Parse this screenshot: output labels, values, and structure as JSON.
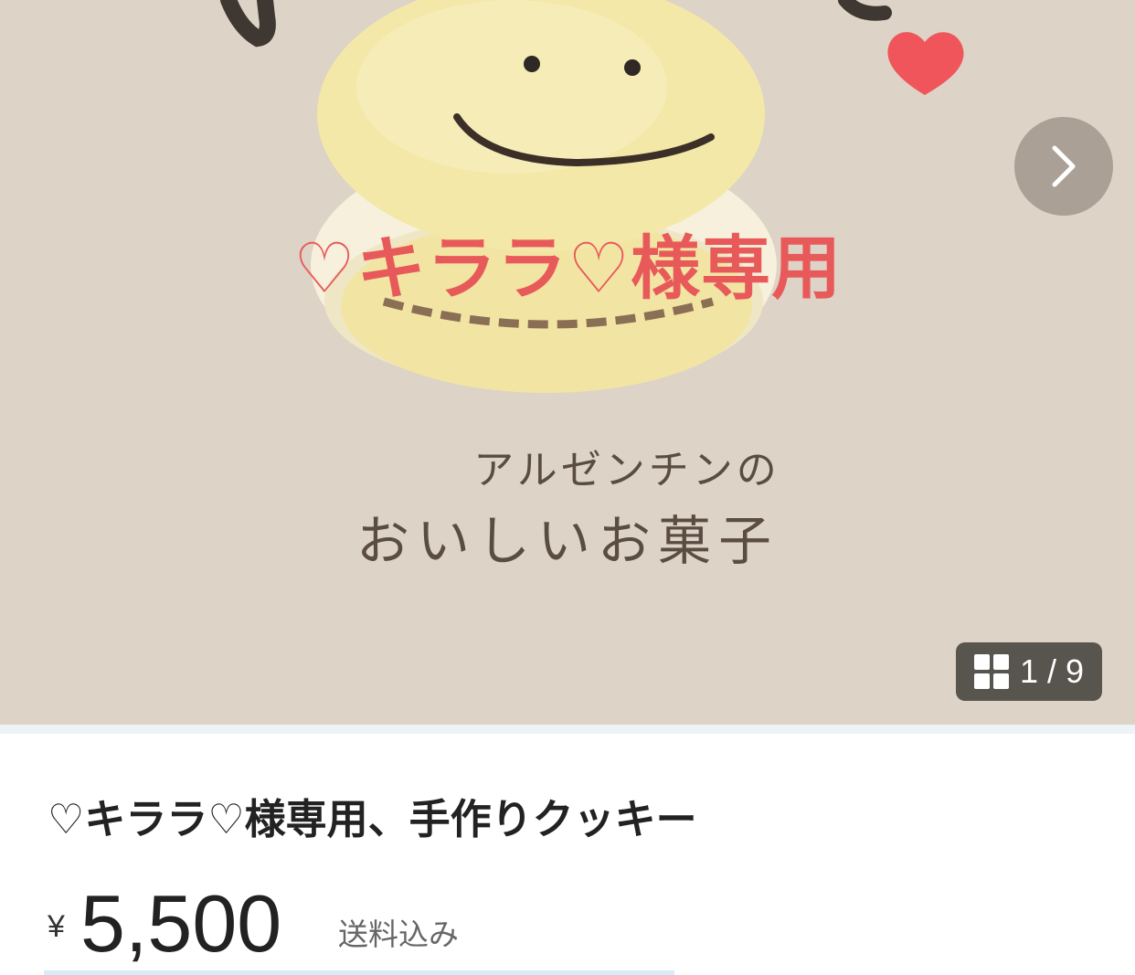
{
  "gallery": {
    "overlay_title": "♡キララ♡様専用",
    "handwriting_line1": "アルゼンチンの",
    "handwriting_line2": "おいしいお菓子",
    "counter": "1 / 9",
    "next_icon": "chevron-right-icon",
    "counter_icon": "grid-icon"
  },
  "item": {
    "title": "♡キララ♡様専用、手作りクッキー",
    "currency": "¥",
    "price": "5,500",
    "shipping": "送料込み"
  },
  "colors": {
    "hero_bg": "#ddd3c6",
    "overlay_title": "#e85a5a",
    "heart": "#f0555c",
    "cookie": "#f3e7a6"
  }
}
